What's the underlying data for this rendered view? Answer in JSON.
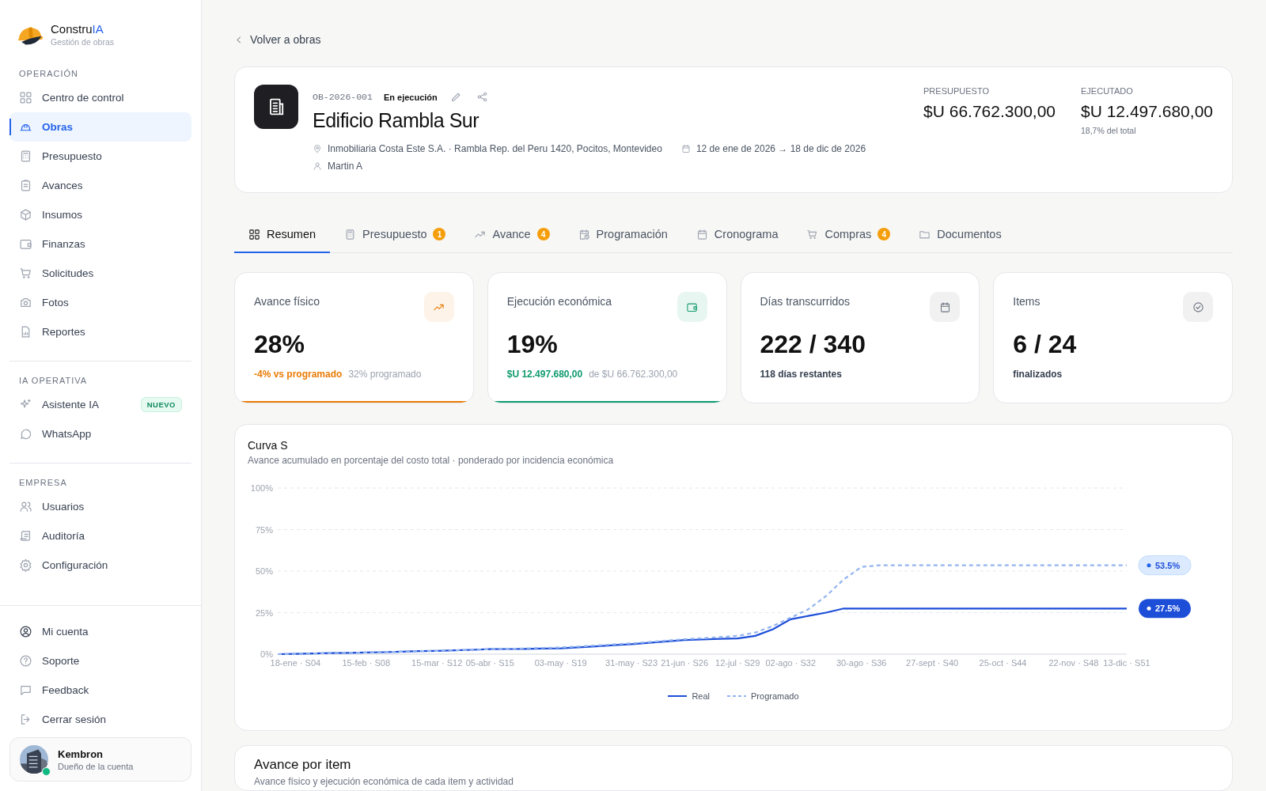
{
  "brand": {
    "name": "Constru",
    "name_accent": "IA",
    "tagline": "Gestión de obras"
  },
  "sidebar": {
    "sections": [
      {
        "title": "OPERACIÓN",
        "items": [
          {
            "label": "Centro de control",
            "selected": false
          },
          {
            "label": "Obras",
            "selected": true
          },
          {
            "label": "Presupuesto",
            "selected": false
          },
          {
            "label": "Avances",
            "selected": false
          },
          {
            "label": "Insumos",
            "selected": false
          },
          {
            "label": "Finanzas",
            "selected": false
          },
          {
            "label": "Solicitudes",
            "selected": false
          },
          {
            "label": "Fotos",
            "selected": false
          },
          {
            "label": "Reportes",
            "selected": false
          }
        ]
      },
      {
        "title": "IA OPERATIVA",
        "items": [
          {
            "label": "Asistente IA",
            "selected": false,
            "badge": "NUEVO"
          },
          {
            "label": "WhatsApp",
            "selected": false
          }
        ]
      },
      {
        "title": "EMPRESA",
        "items": [
          {
            "label": "Usuarios",
            "selected": false
          },
          {
            "label": "Auditoría",
            "selected": false
          },
          {
            "label": "Configuración",
            "selected": false
          }
        ]
      }
    ],
    "footer_items": [
      {
        "label": "Mi cuenta"
      },
      {
        "label": "Soporte"
      },
      {
        "label": "Feedback"
      },
      {
        "label": "Cerrar sesión"
      }
    ],
    "user": {
      "name": "Kembron",
      "role": "Dueño de la cuenta",
      "online": true
    }
  },
  "back_link": "Volver a obras",
  "project": {
    "code": "OB-2026-001",
    "status": "En ejecución",
    "title": "Edificio Rambla Sur",
    "location": "Inmobiliaria Costa Este S.A. · Rambla Rep. del Peru 1420, Pocitos, Montevideo",
    "dates": "12 de ene de 2026 → 18 de dic de 2026",
    "manager": "Martin A",
    "figures": [
      {
        "label": "PRESUPUESTO",
        "value": "$U 66.762.300,00"
      },
      {
        "label": "EJECUTADO",
        "value": "$U 12.497.680,00",
        "note": "18,7% del total"
      }
    ]
  },
  "tabs": [
    {
      "label": "Resumen",
      "selected": true
    },
    {
      "label": "Presupuesto",
      "selected": false,
      "count": "1"
    },
    {
      "label": "Avance",
      "selected": false,
      "count": "4"
    },
    {
      "label": "Programación",
      "selected": false
    },
    {
      "label": "Cronograma",
      "selected": false
    },
    {
      "label": "Compras",
      "selected": false,
      "count": "4"
    },
    {
      "label": "Documentos",
      "selected": false
    }
  ],
  "stats": [
    {
      "title": "Avance físico",
      "value": "28%",
      "note": "-4% vs programado",
      "note_secondary": "32% programado",
      "color": "#ea7c07"
    },
    {
      "title": "Ejecución económica",
      "value": "19%",
      "note": "$U 12.497.680,00",
      "note_secondary": "de $U 66.762.300,00",
      "color": "#0f9b6e"
    },
    {
      "title": "Días transcurridos",
      "value": "222 / 340",
      "note": "118 días restantes"
    },
    {
      "title": "Items",
      "value": "6 / 24",
      "note": "finalizados"
    }
  ],
  "s_curve": {
    "title": "Curva S",
    "subtitle": "Avance acumulado en porcentaje del costo total · ponderado por incidencia económica",
    "chart_data": {
      "type": "line",
      "categories": [
        null,
        "18-ene · S04",
        null,
        null,
        null,
        "15-feb · S08",
        null,
        null,
        null,
        "15-mar · S12",
        null,
        null,
        "05-abr · S15",
        null,
        null,
        null,
        "03-may · S19",
        null,
        null,
        null,
        "31-may · S23",
        null,
        null,
        "21-jun · S26",
        null,
        null,
        "12-jul · S29",
        null,
        null,
        "02-ago · S32",
        null,
        null,
        null,
        "30-ago · S36",
        null,
        null,
        null,
        "27-sept · S40",
        null,
        null,
        null,
        "25-oct · S44",
        null,
        null,
        null,
        "22-nov · S48",
        null,
        null,
        "13-dic · S51"
      ],
      "series": [
        {
          "name": "Real",
          "color": "#1d4ed8",
          "line_style": "solid",
          "values": [
            0,
            0.2,
            0.4,
            0.6,
            0.8,
            1,
            1.2,
            1.5,
            1.8,
            2,
            2.3,
            2.6,
            3,
            3.1,
            3.2,
            3.4,
            3.5,
            4.1,
            4.7,
            5.4,
            6,
            6.8,
            7.7,
            8.5,
            8.8,
            9.2,
            9.5,
            11,
            15,
            21,
            23,
            25,
            27.5,
            27.5,
            27.5,
            27.5,
            27.5,
            27.5,
            27.5,
            27.5,
            27.5,
            27.5,
            27.5,
            27.5,
            27.5,
            27.5,
            27.5,
            27.5,
            27.5
          ]
        },
        {
          "name": "Programado",
          "color": "#93b4f0",
          "line_style": "dashed",
          "values": [
            0,
            0.2,
            0.4,
            0.6,
            0.8,
            1,
            1.2,
            1.5,
            1.8,
            2,
            2.3,
            2.6,
            3,
            3.2,
            3.5,
            3.8,
            4,
            4.6,
            5.2,
            5.9,
            6.5,
            7.3,
            8.2,
            9,
            9.6,
            10.3,
            11,
            13,
            17,
            22,
            27,
            35,
            45,
            52.5,
            53.5,
            53.5,
            53.5,
            53.5,
            53.5,
            53.5,
            53.5,
            53.5,
            53.5,
            53.5,
            53.5,
            53.5,
            53.5,
            53.5,
            53.5
          ]
        }
      ],
      "ylim": [
        0,
        100
      ],
      "grid": true,
      "yticks": [
        {
          "value": 0,
          "label": "0%"
        },
        {
          "value": 25,
          "label": "25%"
        },
        {
          "value": 50,
          "label": "50%"
        },
        {
          "value": 75,
          "label": "75%"
        },
        {
          "value": 100,
          "label": "100%"
        }
      ],
      "annotations": [
        "53.5%",
        "27.5%"
      ]
    }
  },
  "item_progress": {
    "title": "Avance por item",
    "subtitle": "Avance físico y ejecución económica de cada item y actividad"
  }
}
